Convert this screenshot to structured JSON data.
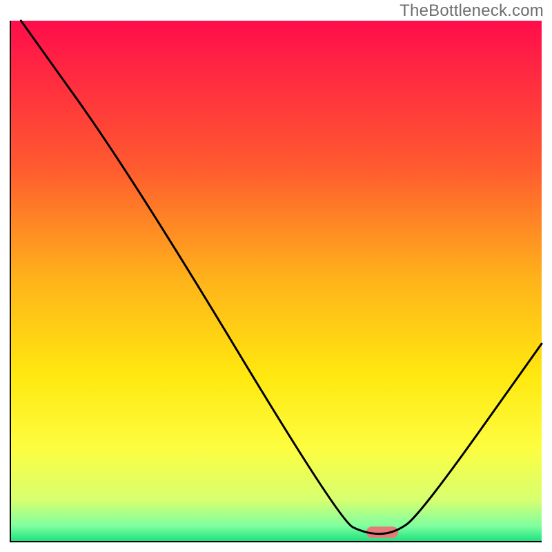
{
  "watermark": "TheBottleneck.com",
  "chart_data": {
    "type": "line",
    "title": "",
    "xlabel": "",
    "ylabel": "",
    "xlim": [
      0,
      100
    ],
    "ylim": [
      0,
      100
    ],
    "background_gradient": {
      "stops": [
        {
          "offset": 0.0,
          "color": "#ff0d4b"
        },
        {
          "offset": 0.28,
          "color": "#ff5a2f"
        },
        {
          "offset": 0.5,
          "color": "#ffb41a"
        },
        {
          "offset": 0.68,
          "color": "#ffe80f"
        },
        {
          "offset": 0.82,
          "color": "#fdfd40"
        },
        {
          "offset": 0.92,
          "color": "#d7ff70"
        },
        {
          "offset": 0.97,
          "color": "#7fffa0"
        },
        {
          "offset": 1.0,
          "color": "#1be07e"
        }
      ]
    },
    "curve": [
      {
        "x": 2,
        "y": 100
      },
      {
        "x": 23,
        "y": 70
      },
      {
        "x": 62,
        "y": 4
      },
      {
        "x": 67,
        "y": 1.5
      },
      {
        "x": 72,
        "y": 1.5
      },
      {
        "x": 77,
        "y": 5
      },
      {
        "x": 100,
        "y": 38
      }
    ],
    "marker": {
      "x": 70,
      "y": 1.8,
      "width": 6,
      "height": 2.2,
      "color": "#e77a79"
    },
    "axis": {
      "stroke": "#000000",
      "stroke_width": 2
    }
  }
}
